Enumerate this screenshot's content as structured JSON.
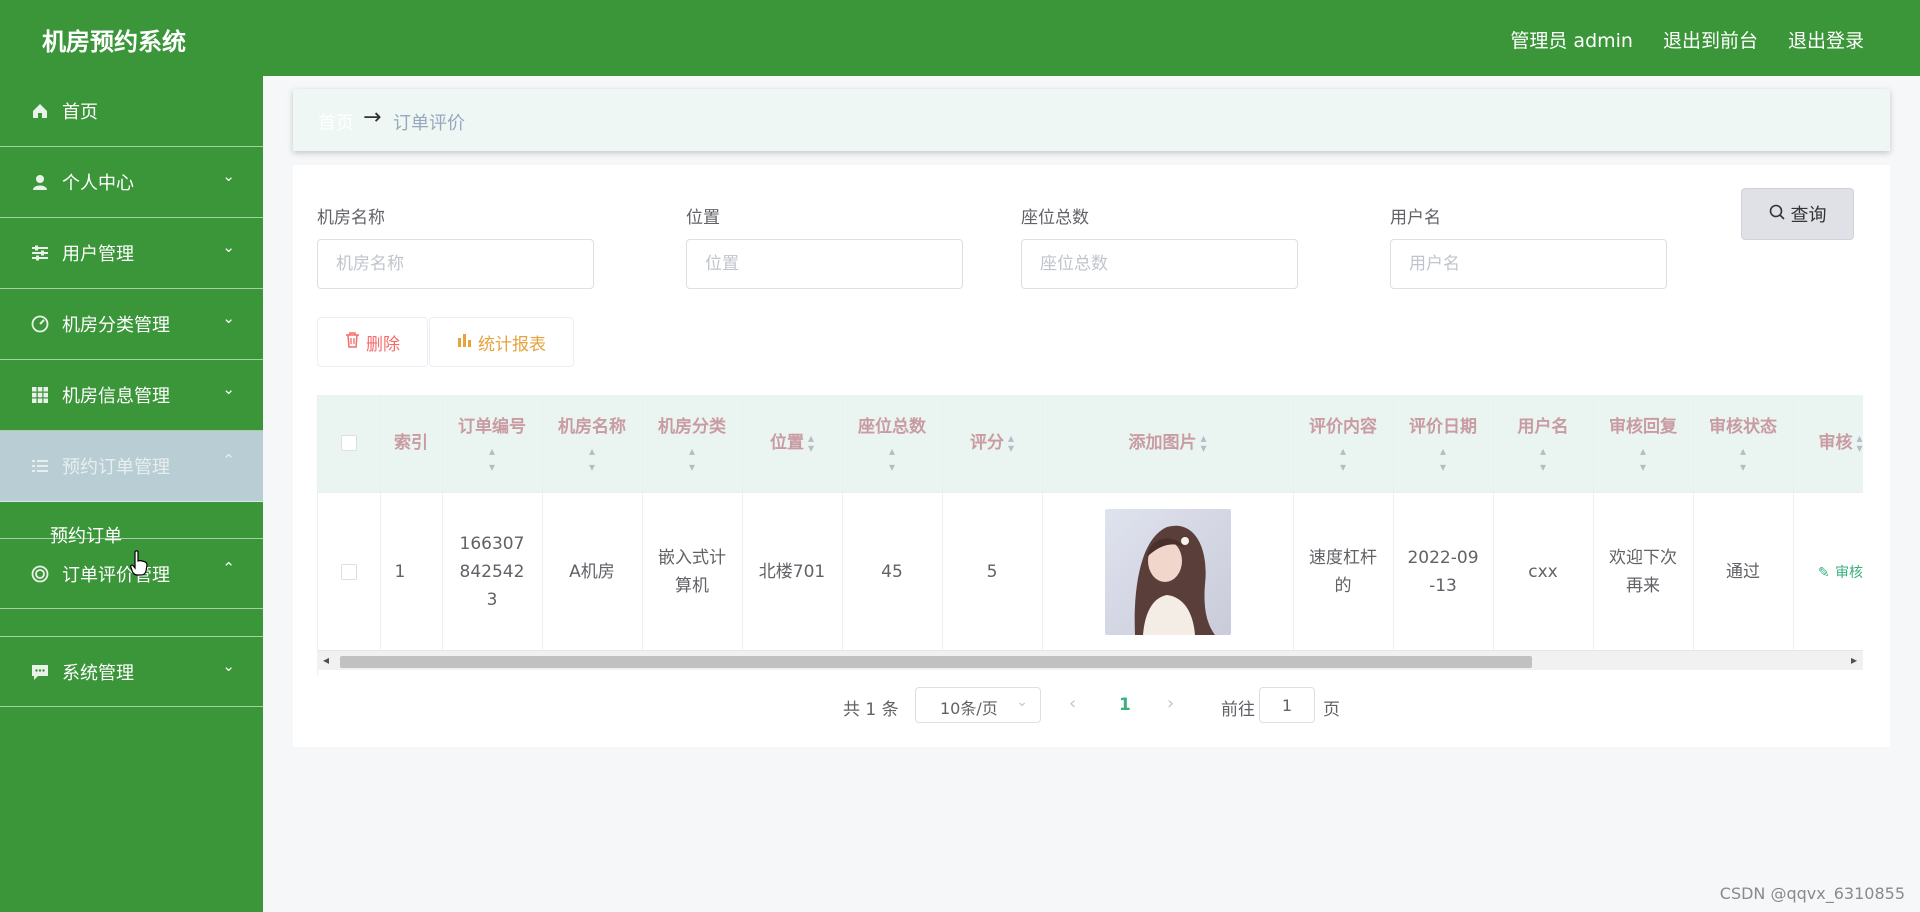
{
  "app": {
    "title": "机房预约系统"
  },
  "header": {
    "admin_label": "管理员 admin",
    "front_label": "退出到前台",
    "logout_label": "退出登录"
  },
  "sidebar": {
    "items": [
      {
        "label": "首页",
        "icon": "home-icon"
      },
      {
        "label": "个人中心",
        "icon": "user-icon"
      },
      {
        "label": "用户管理",
        "icon": "sliders-icon"
      },
      {
        "label": "机房分类管理",
        "icon": "gauge-icon"
      },
      {
        "label": "机房信息管理",
        "icon": "grid-icon"
      },
      {
        "label": "预约订单管理",
        "icon": "list-icon"
      },
      {
        "label": "订单评价管理",
        "icon": "target-icon"
      },
      {
        "label": "系统管理",
        "icon": "chat-icon"
      }
    ],
    "sub_item": "预约订单"
  },
  "breadcrumb": {
    "home": "首页",
    "arrow": "→",
    "current": "订单评价"
  },
  "search": {
    "fields": [
      {
        "label": "机房名称",
        "placeholder": "机房名称"
      },
      {
        "label": "位置",
        "placeholder": "位置"
      },
      {
        "label": "座位总数",
        "placeholder": "座位总数"
      },
      {
        "label": "用户名",
        "placeholder": "用户名"
      }
    ],
    "button": "查询"
  },
  "actions": {
    "delete": "删除",
    "stats": "统计报表"
  },
  "table": {
    "columns": [
      "索引",
      "订单编号",
      "机房名称",
      "机房分类",
      "位置",
      "座位总数",
      "评分",
      "添加图片",
      "评价内容",
      "评价日期",
      "用户名",
      "审核回复",
      "审核状态",
      "审核"
    ],
    "rows": [
      {
        "index": "1",
        "order_no": "1663078425423",
        "room_name": "A机房",
        "room_category": "嵌入式计算机",
        "location": "北楼701",
        "seats": "45",
        "score": "5",
        "content": "速度杠杆的",
        "date": "2022-09-13",
        "username": "cxx",
        "reply": "欢迎下次再来",
        "status": "通过",
        "op": "审核"
      }
    ]
  },
  "pagination": {
    "total": "共 1 条",
    "page_size": "10条/页",
    "current": "1",
    "goto": "前往",
    "goto_value": "1",
    "page_unit": "页"
  },
  "watermark": "CSDN @qqvx_6310855",
  "colors": {
    "primary": "#3b963a",
    "active_menu": "#b8ced4",
    "header_row": "#eaf5f1",
    "accent": "#3ab07f",
    "danger": "#f56c6c",
    "warning": "#e6a23c"
  }
}
